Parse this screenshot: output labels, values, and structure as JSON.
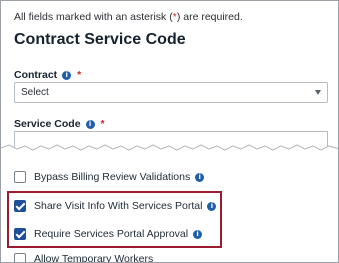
{
  "form": {
    "required_note_pre": "All fields marked with an asterisk (",
    "required_note_ast": "*",
    "required_note_post": ") are required.",
    "title": "Contract Service Code",
    "contract": {
      "label": "Contract",
      "required": "*",
      "selected": "Select"
    },
    "service_code": {
      "label": "Service Code",
      "required": "*",
      "value": ""
    },
    "options": [
      {
        "label": "Bypass Billing Review Validations",
        "checked": false
      },
      {
        "label": "Share Visit Info With Services Portal",
        "checked": true
      },
      {
        "label": "Require Services Portal Approval",
        "checked": true
      },
      {
        "label": "Allow Temporary Workers",
        "checked": false
      }
    ]
  },
  "icons": {
    "info": "info-icon",
    "caret": "chevron-down-icon"
  },
  "colors": {
    "highlight": "#9b1c2e",
    "checkbox": "#1f4f99",
    "info": "#1f5fa8",
    "required": "#c0312e"
  }
}
